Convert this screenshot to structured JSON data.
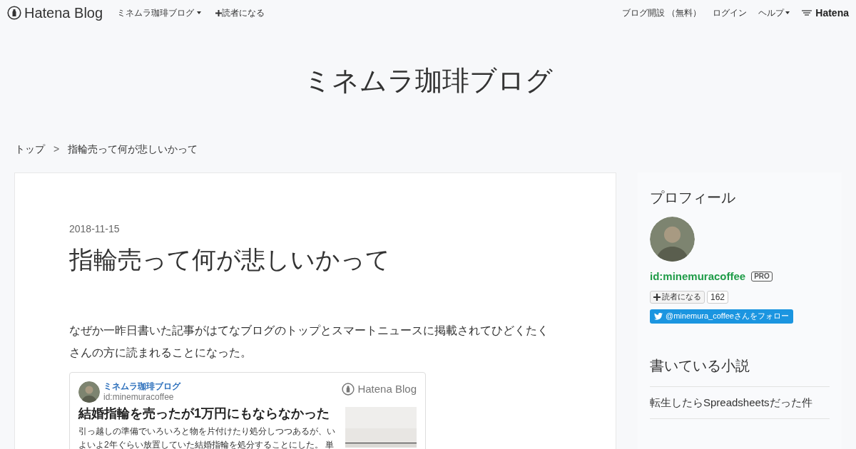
{
  "topbar": {
    "logo": "Hatena Blog",
    "blog_menu": "ミネムラ珈琲ブログ",
    "subscribe": "読者になる",
    "right_links": [
      {
        "label": "ブログ開設 （無料）",
        "dropdown": false
      },
      {
        "label": "ログイン",
        "dropdown": false
      },
      {
        "label": "ヘルプ",
        "dropdown": true
      }
    ],
    "brand": "Hatena"
  },
  "blog_title": "ミネムラ珈琲ブログ",
  "breadcrumb": [
    "トップ",
    "指輪売って何が悲しいかって"
  ],
  "breadcrumb_separator": ">",
  "article": {
    "date": "2018-11-15",
    "title": "指輪売って何が悲しいかって",
    "paragraph": "なぜか一昨日書いた記事がはてなブログのトップとスマートニュースに掲載されてひどくたくさんの方に読まれることになった。",
    "embed": {
      "blog_name": "ミネムラ珈琲ブログ",
      "user_id": "id:minemuracoffee",
      "logo": "Hatena Blog",
      "title": "結婚指輪を売ったが1万円にもならなかった",
      "excerpt": "引っ越しの準備でいろいろと物を片付けたり処分しつつあるが、いよいよ2年ぐらい放置していた結婚指輪を処分することにした。 単"
    }
  },
  "sidebar": {
    "profile": {
      "heading": "プロフィール",
      "user_id": "id:minemuracoffee",
      "badge": "PRO",
      "subscribe": "読者になる",
      "subscriber_count": "162",
      "twitter_follow": "@minemura_coffeeさんをフォロー"
    },
    "novels": {
      "heading": "書いている小説",
      "items": [
        "転生したらSpreadsheetsだった件"
      ]
    }
  }
}
